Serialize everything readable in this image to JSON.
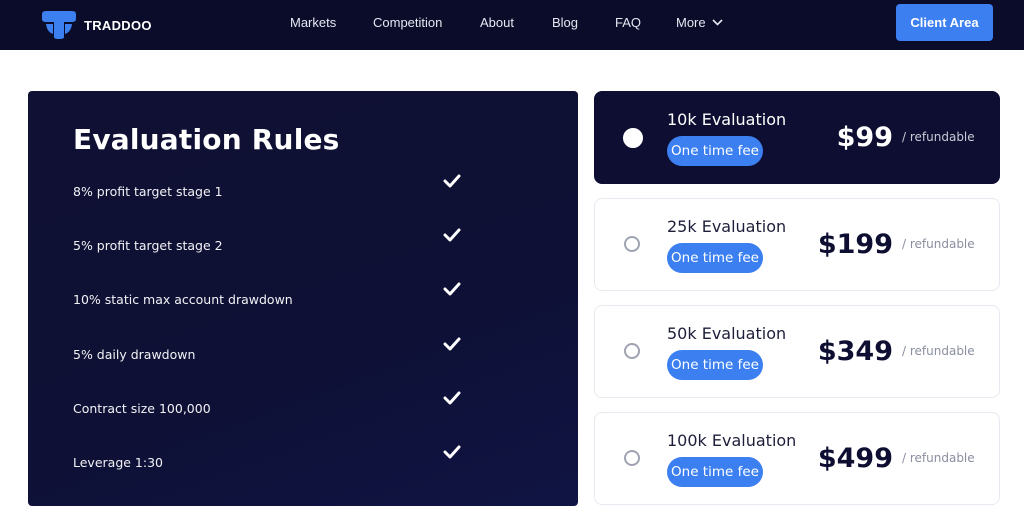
{
  "brand": {
    "name": "TRADDOO"
  },
  "nav": {
    "items": [
      "Markets",
      "Competition",
      "About",
      "Blog",
      "FAQ"
    ],
    "more_label": "More",
    "client_area_label": "Client Area"
  },
  "rules": {
    "title": "Evaluation Rules",
    "items": [
      "8% profit target stage 1",
      "5% profit target stage 2",
      "10% static max account drawdown",
      "5% daily drawdown",
      "Contract size 100,000",
      "Leverage 1:30"
    ]
  },
  "plans": [
    {
      "name": "10k Evaluation",
      "badge": "One time fee",
      "price": "$99",
      "note": "/ refundable",
      "selected": true
    },
    {
      "name": "25k Evaluation",
      "badge": "One time fee",
      "price": "$199",
      "note": "/ refundable",
      "selected": false
    },
    {
      "name": "50k Evaluation",
      "badge": "One time fee",
      "price": "$349",
      "note": "/ refundable",
      "selected": false
    },
    {
      "name": "100k Evaluation",
      "badge": "One time fee",
      "price": "$499",
      "note": "/ refundable",
      "selected": false
    }
  ],
  "colors": {
    "accent": "#3b7ff0",
    "dark": "#0d0e31"
  }
}
